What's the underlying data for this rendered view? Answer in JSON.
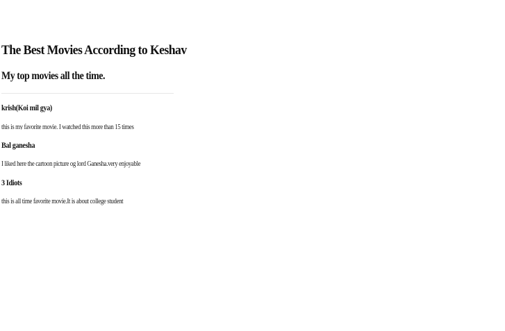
{
  "page": {
    "title": "The Best Movies According to Keshav",
    "subtitle": "My top movies all the time."
  },
  "movies": [
    {
      "title": "krish(Koi mil gya)",
      "description": "this is my favorite movie. I watched this more than 15 times"
    },
    {
      "title": "Bal ganesha",
      "description": "I liked here the cartoon picture og lord Ganesha.very enjoyable"
    },
    {
      "title": "3 Idiots",
      "description": "this is all time favorite movie.It is about college student"
    }
  ]
}
